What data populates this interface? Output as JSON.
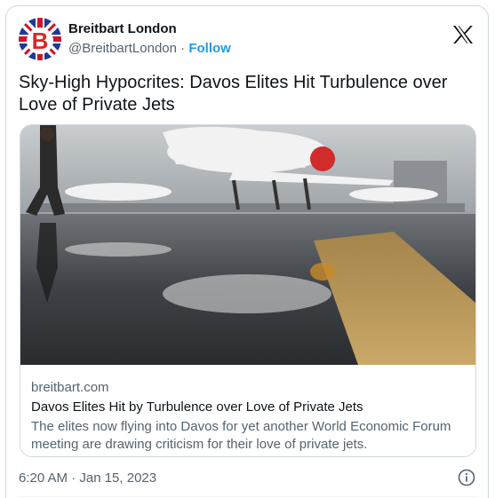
{
  "tweet": {
    "author": {
      "display_name": "Breitbart London",
      "handle": "@BreitbartLondon",
      "separator": "·",
      "follow_label": "Follow",
      "avatar_icon": "breitbart-union-jack-b-logo"
    },
    "text": "Sky-High Hypocrites: Davos Elites Hit Turbulence over Love of Private Jets",
    "link_card": {
      "image_icon": "private-jets-reflection-photo",
      "domain": "breitbart.com",
      "title": "Davos Elites Hit by Turbulence over Love of Private Jets",
      "description": "The elites now flying into Davos for yet another World Economic Forum meeting are drawing criticism for their love of private jets."
    },
    "timestamp": "6:20 AM · Jan 15, 2023",
    "icons": {
      "brand": "x-logo-icon",
      "info": "info-icon"
    },
    "colors": {
      "accent": "#1d9bf0",
      "text": "#0f1419",
      "muted": "#536471",
      "border": "#cfd9de"
    }
  }
}
